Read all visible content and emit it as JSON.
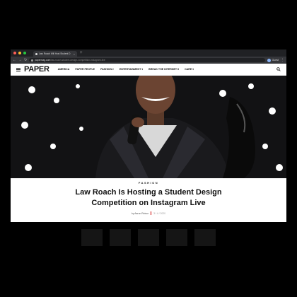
{
  "browser": {
    "tab_title": "Law Roach Will Host Student D",
    "tab_close": "×",
    "new_tab": "+",
    "url_domain": "papermag.com",
    "url_path": "/law-roach-student-design-competition-instagram-live",
    "profile_label": "Guest",
    "traffic_colors": [
      "#ff5f57",
      "#febc2e",
      "#28c840"
    ]
  },
  "site": {
    "logo": "PAPER",
    "nav": [
      "AMERICA",
      "PAPER PEOPLE",
      "FASHION ▾",
      "ENTERTAINMENT ▾",
      "BREAK THE INTERNET II",
      "CARE ▾"
    ]
  },
  "article": {
    "category": "FASHION",
    "title_line1": "Law Roach Is Hosting a Student Design",
    "title_line2": "Competition on Instagram Live",
    "author": "by Aaron Reisor",
    "date": "3 / 4 / 2020"
  }
}
